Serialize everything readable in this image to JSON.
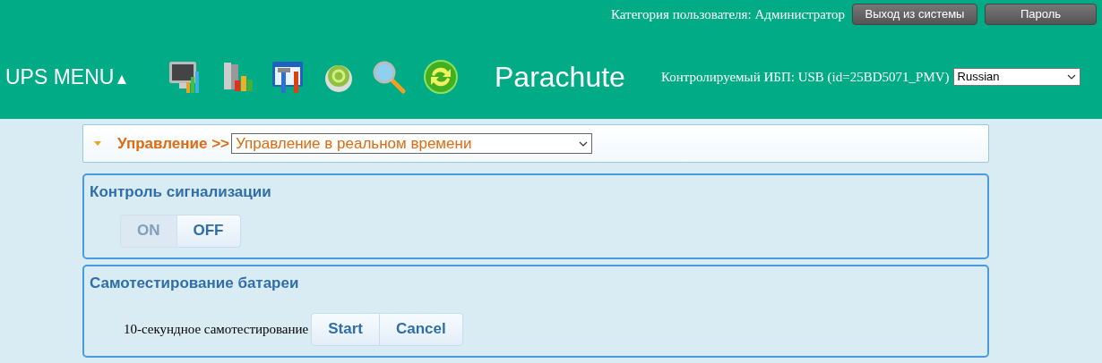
{
  "header": {
    "user_category": "Категория пользователя: Администратор",
    "buttons": [
      "Выход из системы",
      "Пароль"
    ],
    "menu_title": "UPS MENU",
    "menu_arrow": "▲",
    "toolbar": [
      {
        "kind": "monitor"
      },
      {
        "kind": "books"
      },
      {
        "kind": "tools"
      },
      {
        "kind": "gear"
      },
      {
        "kind": "search"
      },
      {
        "kind": "refresh"
      }
    ],
    "logo": "Parachute",
    "monitored_ups": "Контролируемый ИБП: USB (id=25BD5071_PMV)",
    "language": "Russian"
  },
  "breadcrumb": {
    "label": "Управление >>",
    "page": "Управление в реальном времени"
  },
  "panels": [
    {
      "title": "Контроль сигнализации",
      "buttons": [
        {
          "label": "ON",
          "disabled": true
        },
        {
          "label": "OFF",
          "disabled": false
        }
      ]
    },
    {
      "title": "Самотестирование батареи",
      "label": "10-секундное самотестирование",
      "buttons": [
        {
          "label": "Start",
          "disabled": false
        },
        {
          "label": "Cancel",
          "disabled": false
        }
      ]
    }
  ]
}
